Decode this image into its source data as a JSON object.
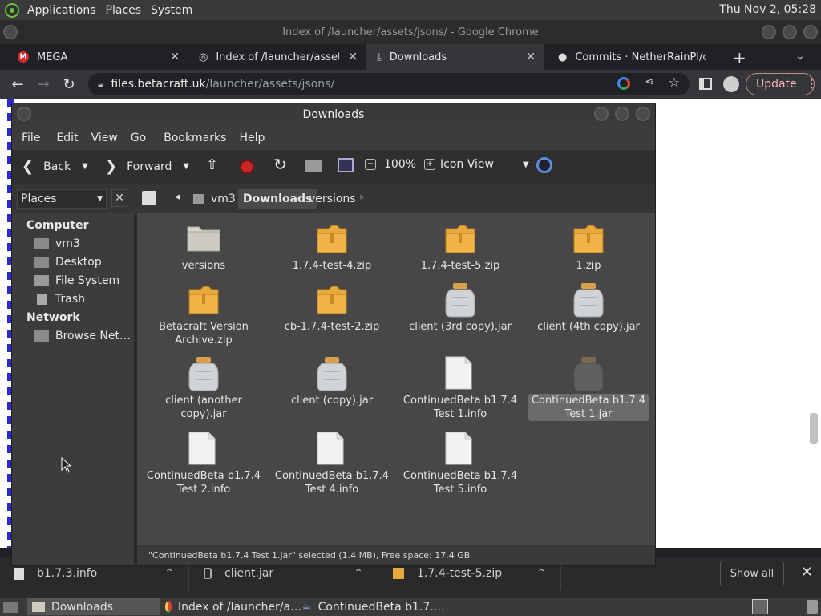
{
  "top_panel": {
    "menus": [
      "Applications",
      "Places",
      "System"
    ],
    "clock": "Thu Nov 2, 05:28"
  },
  "chrome": {
    "window_title": "Index of /launcher/assets/jsons/ - Google Chrome",
    "tabs": [
      {
        "label": "MEGA"
      },
      {
        "label": "Index of /launcher/assets/jsons/"
      },
      {
        "label": "Downloads"
      },
      {
        "label": "Commits · NetherRainPl/co"
      }
    ],
    "url_host": "files.betacraft.uk",
    "url_path": "/launcher/assets/jsons/",
    "update_label": "Update"
  },
  "file_manager": {
    "title": "Downloads",
    "menus": [
      "File",
      "Edit",
      "View",
      "Go",
      "Bookmarks",
      "Help"
    ],
    "toolbar": {
      "back": "Back",
      "forward": "Forward",
      "zoom": "100%",
      "view_mode": "Icon View"
    },
    "places_label": "Places",
    "breadcrumbs": [
      "vm3",
      "Downloads",
      "versions"
    ],
    "sidebar": {
      "computer_header": "Computer",
      "computer_items": [
        "vm3",
        "Desktop",
        "File System",
        "Trash"
      ],
      "network_header": "Network",
      "network_items": [
        "Browse Net…"
      ]
    },
    "files": [
      {
        "name": "versions",
        "icon": "folder-icon"
      },
      {
        "name": "1.7.4-test-4.zip",
        "icon": "archive-icon"
      },
      {
        "name": "1.7.4-test-5.zip",
        "icon": "archive-icon"
      },
      {
        "name": "1.zip",
        "icon": "archive-icon"
      },
      {
        "name": "Betacraft Version Archive.zip",
        "icon": "archive-icon"
      },
      {
        "name": "cb-1.7.4-test-2.zip",
        "icon": "archive-icon"
      },
      {
        "name": "client (3rd copy).jar",
        "icon": "jar-icon"
      },
      {
        "name": "client (4th copy).jar",
        "icon": "jar-icon"
      },
      {
        "name": "client (another copy).jar",
        "icon": "jar-icon"
      },
      {
        "name": "client (copy).jar",
        "icon": "jar-icon"
      },
      {
        "name": "ContinuedBeta b1.7.4 Test 1.info",
        "icon": "document-icon"
      },
      {
        "name": "ContinuedBeta b1.7.4 Test 1.jar",
        "icon": "jar-icon",
        "selected": true
      },
      {
        "name": "ContinuedBeta b1.7.4 Test 2.info",
        "icon": "document-icon"
      },
      {
        "name": "ContinuedBeta b1.7.4 Test 4.info",
        "icon": "document-icon"
      },
      {
        "name": "ContinuedBeta b1.7.4 Test 5.info",
        "icon": "document-icon"
      }
    ],
    "status": "\"ContinuedBeta b1.7.4 Test 1.jar\" selected (1.4 MB), Free space: 17.4 GB"
  },
  "downloads_shelf": {
    "items": [
      "b1.7.3.info",
      "client.jar",
      "1.7.4-test-5.zip"
    ],
    "show_all": "Show all"
  },
  "taskbar": {
    "items": [
      "Downloads",
      "Index of /launcher/a…",
      "ContinuedBeta b1.7.…"
    ]
  },
  "colors": {
    "folder": "#d9d6cc",
    "archive": "#e8a93c",
    "selection": "#6b6b6b"
  }
}
